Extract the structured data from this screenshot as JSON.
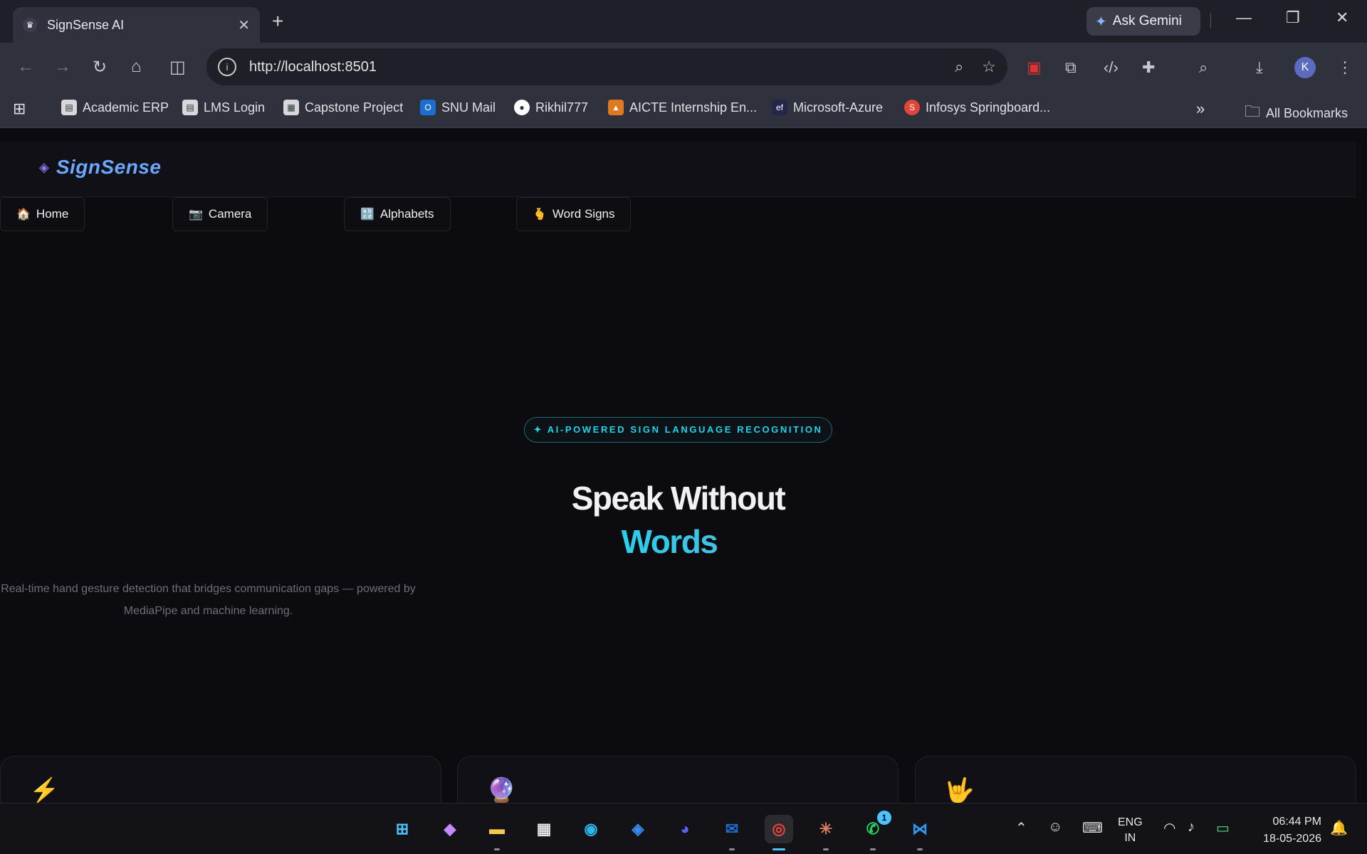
{
  "browser": {
    "tab_title": "SignSense AI",
    "ask_gemini": "Ask Gemini",
    "url": "http://localhost:8501",
    "profile_initial": "K",
    "bookmarks": [
      {
        "label": "Academic ERP",
        "icon": "erp-icon"
      },
      {
        "label": "LMS Login",
        "icon": "lms-icon"
      },
      {
        "label": "Capstone Project",
        "icon": "capstone-icon"
      },
      {
        "label": "SNU Mail",
        "icon": "outlook-icon"
      },
      {
        "label": "Rikhil777",
        "icon": "github-icon"
      },
      {
        "label": "AICTE Internship En...",
        "icon": "aicte-icon"
      },
      {
        "label": "Microsoft-Azure",
        "icon": "ef-icon"
      },
      {
        "label": "Infosys Springboard...",
        "icon": "springboard-icon"
      }
    ],
    "all_bookmarks": "All Bookmarks"
  },
  "app": {
    "brand": "SignSense",
    "nav": [
      {
        "icon": "🏠",
        "label": "Home"
      },
      {
        "icon": "📷",
        "label": "Camera"
      },
      {
        "icon": "🔡",
        "label": "Alphabets"
      },
      {
        "icon": "🫰",
        "label": "Word Signs"
      }
    ],
    "badge": "✦ AI-POWERED SIGN LANGUAGE RECOGNITION",
    "hero_line1": "Speak Without",
    "hero_line2": "Words",
    "subtitle": "Real-time hand gesture detection that bridges communication gaps — powered by MediaPipe and machine learning.",
    "cards": [
      {
        "icon": "⚡"
      },
      {
        "icon": "🔮"
      },
      {
        "icon": "🤟"
      }
    ],
    "colors": {
      "accent": "#22d3ee",
      "brand": "#6aa8ff",
      "gradient_start": "#6d7cff",
      "gradient_end": "#f061b0",
      "background": "#0b0b10"
    }
  },
  "taskbar": {
    "language": "ENG",
    "region": "IN",
    "time": "06:44 PM",
    "date": "18-05-2026",
    "whatsapp_badge": "1"
  }
}
